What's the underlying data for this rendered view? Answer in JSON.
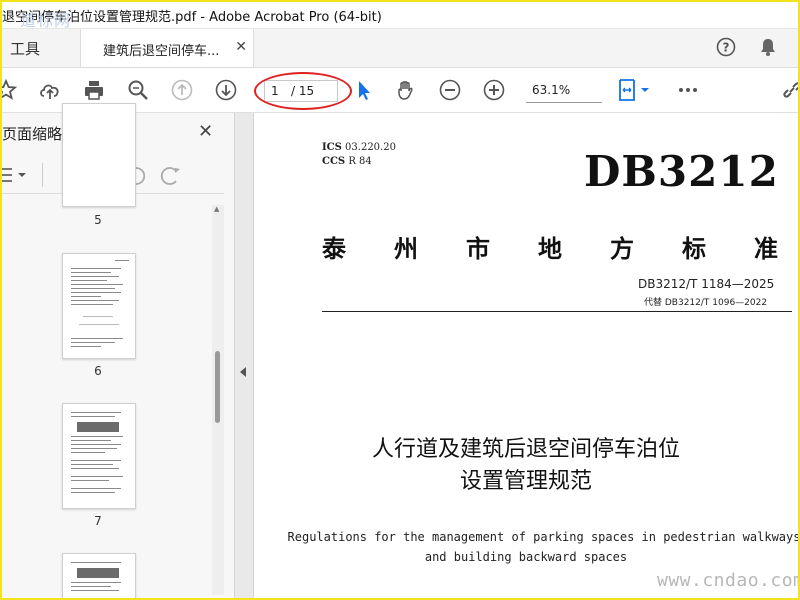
{
  "window": {
    "title": "退空间停车泊位设置管理规范.pdf - Adobe Acrobat Pro (64-bit)",
    "watermark_top": "道标网"
  },
  "tabs": {
    "tools_label": "工具",
    "doc_tab_label": "建筑后退空间停车...",
    "close_symbol": "✕"
  },
  "toolbar": {
    "page_current": "1",
    "page_total": "/ 15",
    "zoom": "63.1%",
    "icons": [
      "star-icon",
      "cloud-upload-icon",
      "print-icon",
      "zoom-search-icon",
      "page-up-icon",
      "page-down-icon",
      "select-cursor-icon",
      "hand-icon",
      "zoom-out-icon",
      "zoom-in-icon",
      "fit-page-icon",
      "more-icon",
      "link-icon"
    ],
    "accent_color": "#1473e6",
    "highlight_color": "#e02020"
  },
  "left_panel": {
    "title": "页面缩略图",
    "close_symbol": "✕",
    "pages": [
      {
        "label": "5"
      },
      {
        "label": "6"
      },
      {
        "label": "7"
      }
    ]
  },
  "document": {
    "ics_label": "ICS",
    "ics_value": "03.220.20",
    "ccs_label": "CCS",
    "ccs_value": "R 84",
    "db_code": "DB3212",
    "std_type_chars": [
      "泰",
      "州",
      "市",
      "地",
      "方",
      "标",
      "准"
    ],
    "std_number": "DB3212/T 1184—2025",
    "replaces": "代替 DB3212/T 1096—2022",
    "title_line1": "人行道及建筑后退空间停车泊位",
    "title_line2": "设置管理规范",
    "en_title_line1": "Regulations for the management of parking spaces in pedestrian walkways",
    "en_title_line2": "and building backward spaces"
  },
  "watermark_bottom": "www.cndao.com"
}
